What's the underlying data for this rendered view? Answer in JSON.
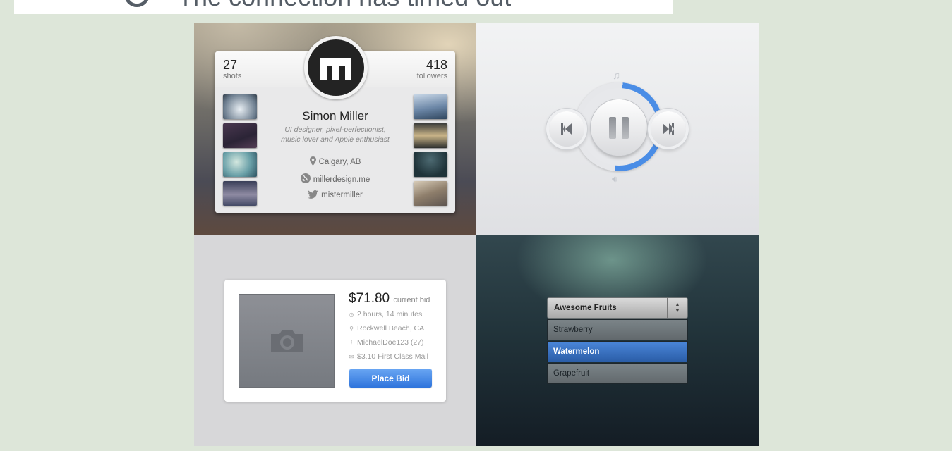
{
  "banner": {
    "title": "The connection has timed out"
  },
  "profile": {
    "shots_count": "27",
    "shots_label": "shots",
    "followers_count": "418",
    "followers_label": "followers",
    "name": "Simon Miller",
    "bio": "UI designer, pixel-perfectionist, music lover and Apple enthusiast",
    "location": "Calgary, AB",
    "website": "millerdesign.me",
    "twitter": "mistermiller"
  },
  "player": {
    "progress": 0.5,
    "accent": "#4a8de6"
  },
  "bid": {
    "price": "$71.80",
    "price_label": "current bid",
    "time_left": "2 hours, 14 minutes",
    "location": "Rockwell Beach, CA",
    "seller": "MichaelDoe123 (27)",
    "shipping": "$3.10 First Class Mail",
    "button": "Place Bid"
  },
  "dropdown": {
    "selected": "Awesome Fruits",
    "options": [
      "Strawberry",
      "Watermelon",
      "Grapefruit"
    ],
    "highlighted": "Watermelon"
  }
}
